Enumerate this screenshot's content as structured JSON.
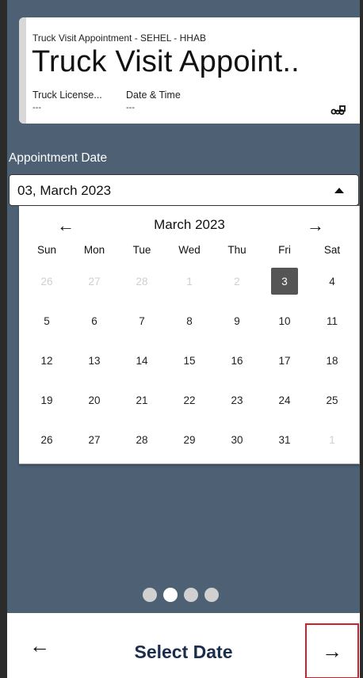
{
  "header": {
    "subtitle": "Truck Visit Appointment - SEHEL - HHAB",
    "title": "Truck Visit Appoint..",
    "fields": [
      {
        "label": "Truck License...",
        "value": "---"
      },
      {
        "label": "Date & Time",
        "value": "---"
      }
    ],
    "icon": "truck-icon"
  },
  "appointment": {
    "label": "Appointment Date",
    "selected_value": "03, March 2023"
  },
  "calendar": {
    "month_label": "March 2023",
    "prev_glyph": "←",
    "next_glyph": "→",
    "weekdays": [
      "Sun",
      "Mon",
      "Tue",
      "Wed",
      "Thu",
      "Fri",
      "Sat"
    ],
    "weeks": [
      [
        {
          "d": "26",
          "m": true
        },
        {
          "d": "27",
          "m": true
        },
        {
          "d": "28",
          "m": true
        },
        {
          "d": "1",
          "m": true
        },
        {
          "d": "2",
          "m": true
        },
        {
          "d": "3",
          "sel": true
        },
        {
          "d": "4"
        }
      ],
      [
        {
          "d": "5"
        },
        {
          "d": "6"
        },
        {
          "d": "7"
        },
        {
          "d": "8"
        },
        {
          "d": "9"
        },
        {
          "d": "10"
        },
        {
          "d": "11"
        }
      ],
      [
        {
          "d": "12"
        },
        {
          "d": "13"
        },
        {
          "d": "14"
        },
        {
          "d": "15"
        },
        {
          "d": "16"
        },
        {
          "d": "17"
        },
        {
          "d": "18"
        }
      ],
      [
        {
          "d": "19"
        },
        {
          "d": "20"
        },
        {
          "d": "21"
        },
        {
          "d": "22"
        },
        {
          "d": "23"
        },
        {
          "d": "24"
        },
        {
          "d": "25"
        }
      ],
      [
        {
          "d": "26"
        },
        {
          "d": "27"
        },
        {
          "d": "28"
        },
        {
          "d": "29"
        },
        {
          "d": "30"
        },
        {
          "d": "31"
        },
        {
          "d": "1",
          "m": true
        }
      ]
    ],
    "selected_color": "#555555"
  },
  "pager": {
    "count": 4,
    "active_index": 1
  },
  "bottom": {
    "prev_glyph": "←",
    "title": "Select Date",
    "next_glyph": "→"
  },
  "colors": {
    "background": "#4d6074",
    "title_text": "#1a2d4d",
    "highlight_border": "#d0202b"
  }
}
